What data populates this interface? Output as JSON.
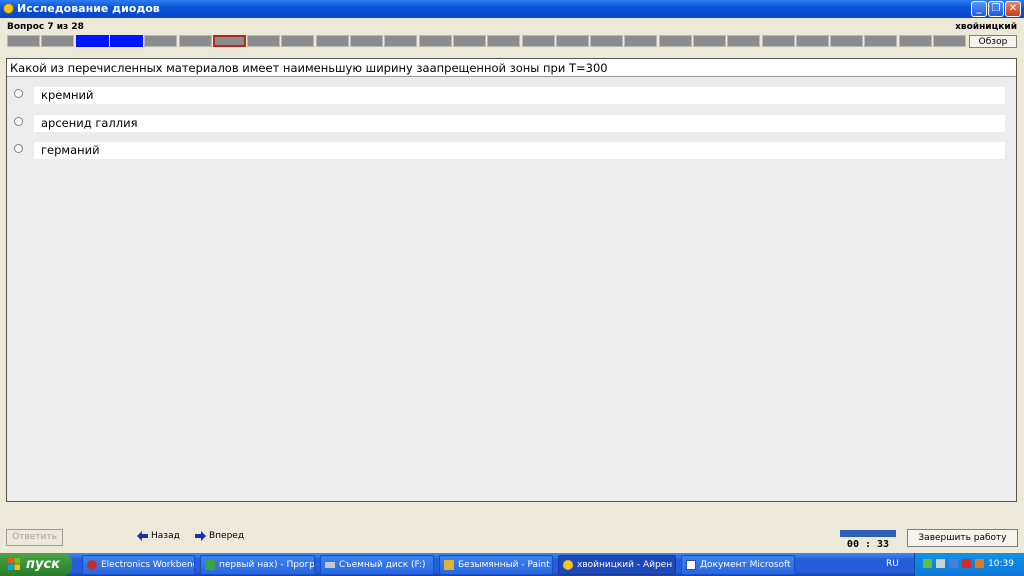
{
  "window": {
    "title": "Исследование диодов",
    "buttons": [
      "minimize",
      "maximize",
      "close"
    ]
  },
  "header": {
    "question_counter": "Вопрос 7 из 28",
    "user_name": "хвойницкий",
    "review_button": "Обзор"
  },
  "progress": {
    "total": 28,
    "answered": [
      3,
      4
    ],
    "current": 7,
    "colors": {
      "unanswered": "#8c8c8c",
      "answered": "#0015ff",
      "current_border": "#b22a20"
    }
  },
  "question": {
    "text": "Какой из перечисленных материалов имеет наименьшую ширину заапрещенной зоны при T=300",
    "options": [
      {
        "label": "кремний"
      },
      {
        "label": "арсенид галлия"
      },
      {
        "label": "германий"
      }
    ]
  },
  "footer": {
    "answer_button": "Ответить",
    "back_label": "Назад",
    "forward_label": "Вперед",
    "timer": "00 : 33",
    "finish_button": "Завершить работу"
  },
  "taskbar": {
    "start_label": "пуск",
    "tasks": [
      {
        "label": "Electronics Workbenc...",
        "icon": "workbench-icon"
      },
      {
        "label": "первый нах) - Прогр...",
        "icon": "image-icon"
      },
      {
        "label": "Съемный диск (F:)",
        "icon": "drive-icon"
      },
      {
        "label": "Безымянный - Paint",
        "icon": "paint-icon"
      },
      {
        "label": "хвойницкий - Айрен",
        "icon": "app-icon",
        "active": true
      },
      {
        "label": "Документ Microsoft ...",
        "icon": "word-icon"
      }
    ],
    "language": "RU",
    "clock": "10:39"
  }
}
